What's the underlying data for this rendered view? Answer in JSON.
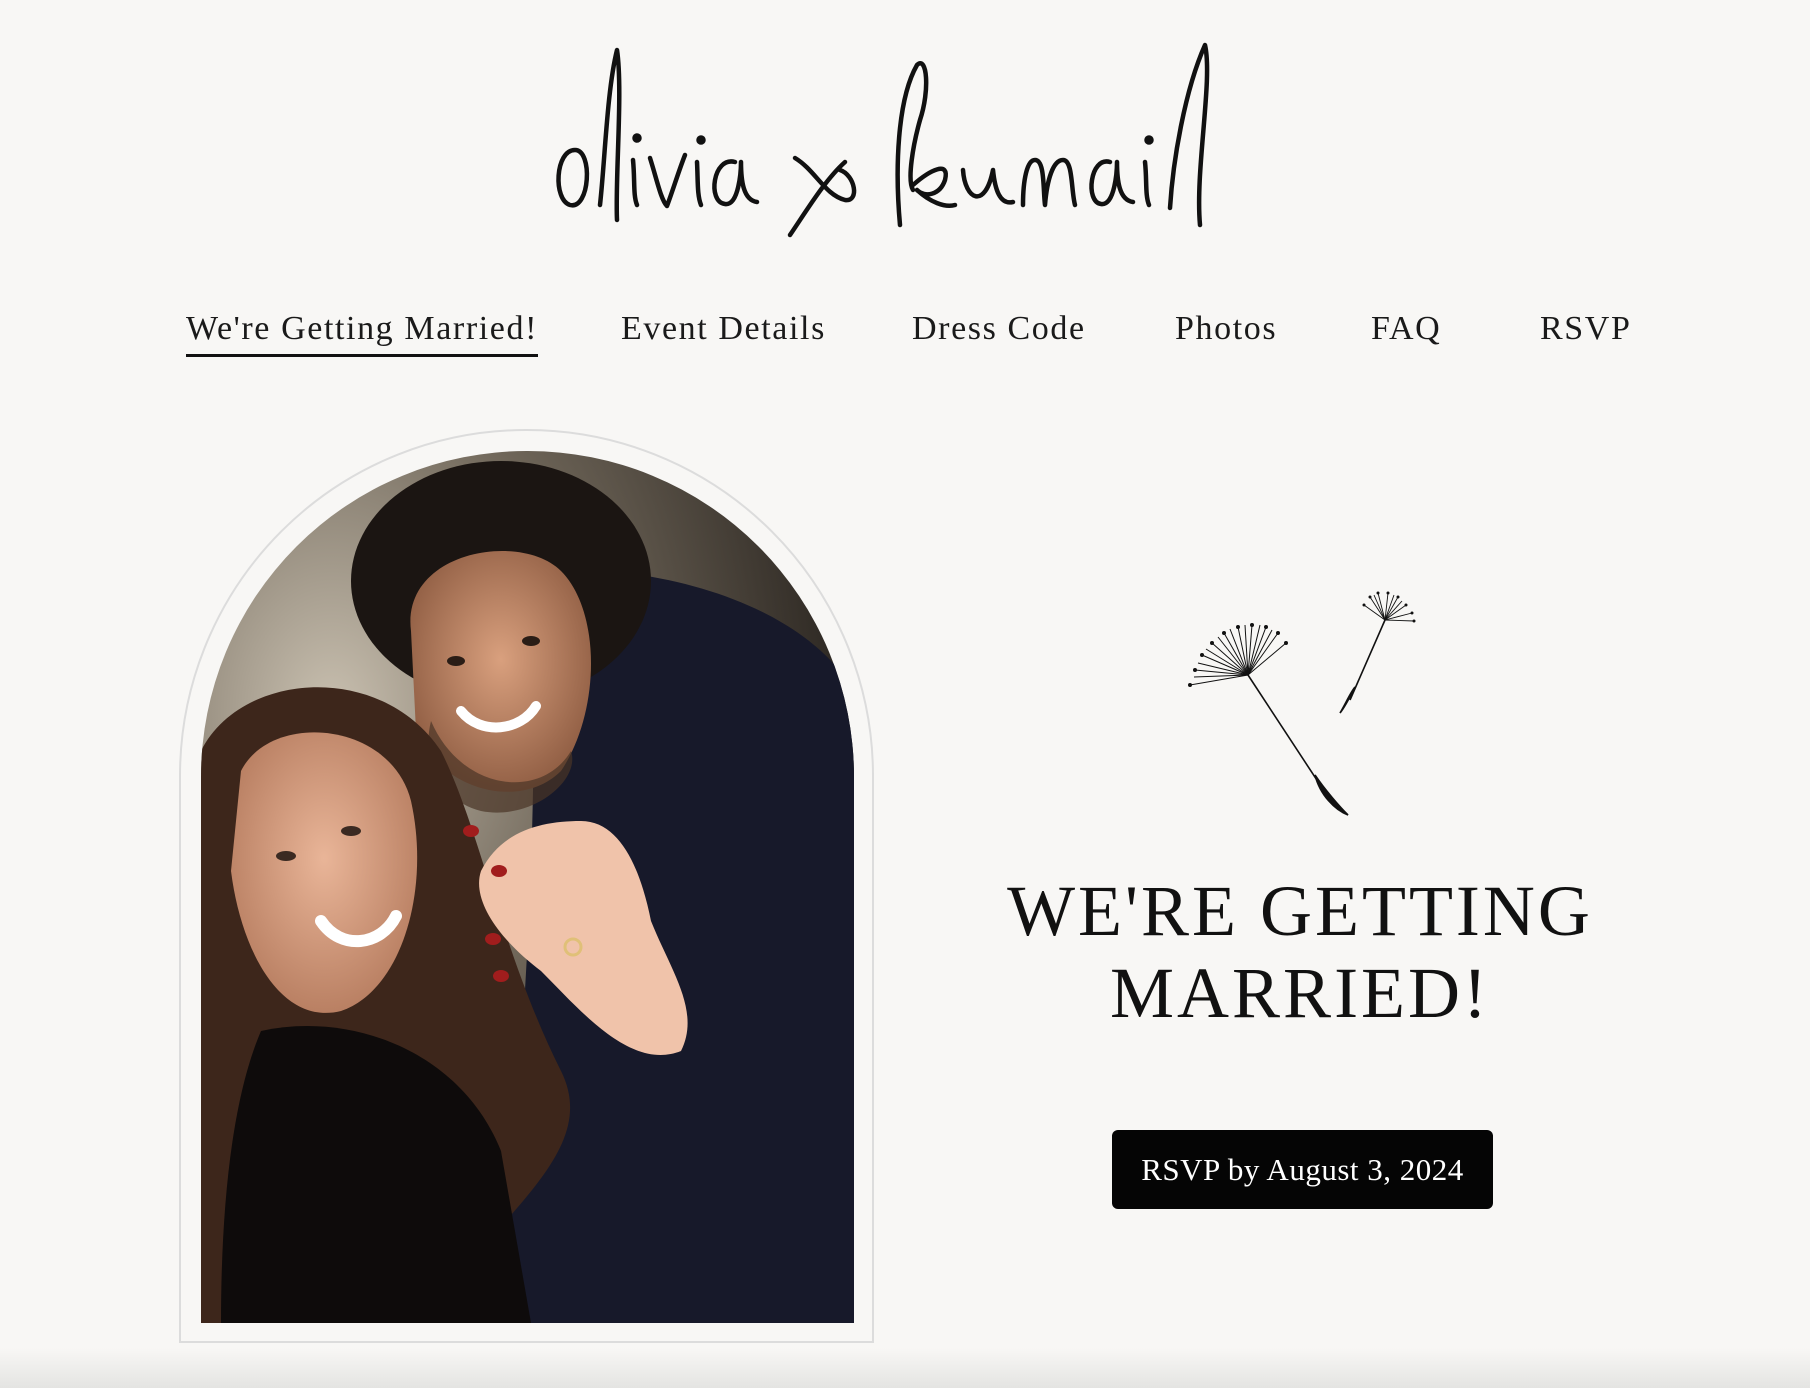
{
  "site": {
    "logo_text": "olivia x kumail"
  },
  "nav": {
    "items": [
      {
        "label": "We're Getting Married!",
        "active": true
      },
      {
        "label": "Event Details",
        "active": false
      },
      {
        "label": "Dress Code",
        "active": false
      },
      {
        "label": "Photos",
        "active": false
      },
      {
        "label": "FAQ",
        "active": false
      },
      {
        "label": "RSVP",
        "active": false
      }
    ]
  },
  "hero": {
    "headline_line1": "WE'RE GETTING",
    "headline_line2": "MARRIED!",
    "rsvp_button_label": "RSVP by August 3, 2024",
    "photo_icon": "engagement-photo",
    "decoration_icon": "dandelion-icon"
  },
  "colors": {
    "background": "#f8f7f5",
    "text": "#111111",
    "button_bg": "#050505",
    "button_text": "#ffffff"
  }
}
